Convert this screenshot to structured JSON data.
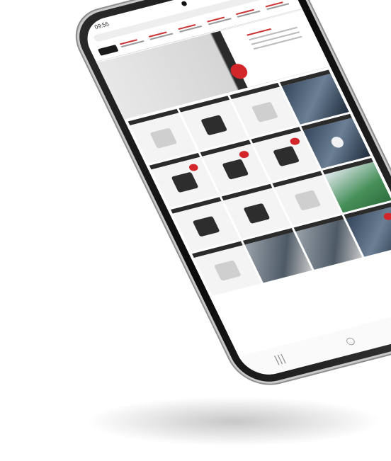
{
  "status_bar": {
    "time": "09:55"
  },
  "system_nav": {
    "recents_icon": "|||",
    "home_icon": "○",
    "back_icon": "‹"
  },
  "colors": {
    "accent": "#d3262b",
    "tile_header": "#2b2b2b",
    "bezel": "#111111"
  }
}
